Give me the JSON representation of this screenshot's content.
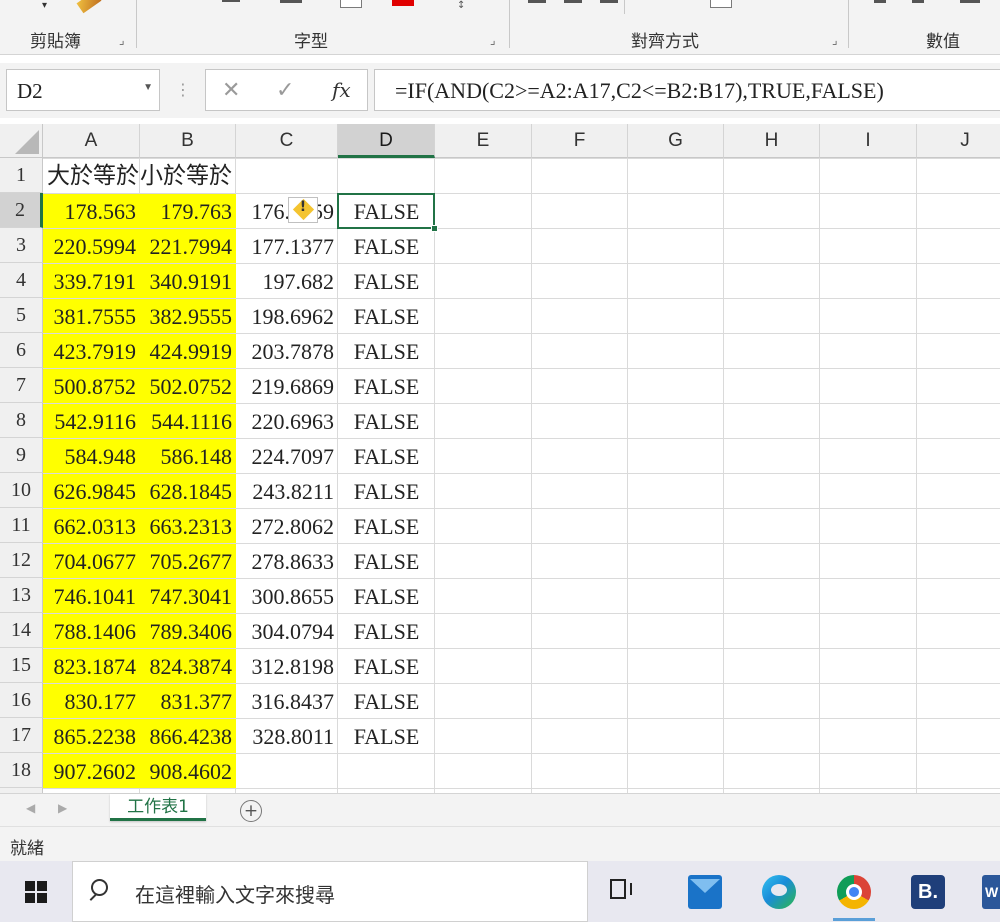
{
  "ribbon": {
    "groups": [
      {
        "label": "剪貼簿"
      },
      {
        "label": "字型"
      },
      {
        "label": "對齊方式"
      },
      {
        "label": "數值"
      }
    ]
  },
  "formula_bar": {
    "name_box": "D2",
    "formula": "=IF(AND(C2>=A2:A17,C2<=B2:B17),TRUE,FALSE)",
    "cancel_glyph": "✕",
    "enter_glyph": "✓",
    "fx_glyph": "fx"
  },
  "sheet": {
    "columns": [
      "A",
      "B",
      "C",
      "D",
      "E",
      "F",
      "G",
      "H",
      "I",
      "J"
    ],
    "active_column": "D",
    "active_row": 2,
    "header_row": {
      "a": "大於等於",
      "b": "小於等於"
    },
    "rows": [
      {
        "num": "2",
        "a": "178.563",
        "b": "179.763",
        "c": "176.1759",
        "d": "FALSE"
      },
      {
        "num": "3",
        "a": "220.5994",
        "b": "221.7994",
        "c": "177.1377",
        "d": "FALSE"
      },
      {
        "num": "4",
        "a": "339.7191",
        "b": "340.9191",
        "c": "197.682",
        "d": "FALSE"
      },
      {
        "num": "5",
        "a": "381.7555",
        "b": "382.9555",
        "c": "198.6962",
        "d": "FALSE"
      },
      {
        "num": "6",
        "a": "423.7919",
        "b": "424.9919",
        "c": "203.7878",
        "d": "FALSE"
      },
      {
        "num": "7",
        "a": "500.8752",
        "b": "502.0752",
        "c": "219.6869",
        "d": "FALSE"
      },
      {
        "num": "8",
        "a": "542.9116",
        "b": "544.1116",
        "c": "220.6963",
        "d": "FALSE"
      },
      {
        "num": "9",
        "a": "584.948",
        "b": "586.148",
        "c": "224.7097",
        "d": "FALSE"
      },
      {
        "num": "10",
        "a": "626.9845",
        "b": "628.1845",
        "c": "243.8211",
        "d": "FALSE"
      },
      {
        "num": "11",
        "a": "662.0313",
        "b": "663.2313",
        "c": "272.8062",
        "d": "FALSE"
      },
      {
        "num": "12",
        "a": "704.0677",
        "b": "705.2677",
        "c": "278.8633",
        "d": "FALSE"
      },
      {
        "num": "13",
        "a": "746.1041",
        "b": "747.3041",
        "c": "300.8655",
        "d": "FALSE"
      },
      {
        "num": "14",
        "a": "788.1406",
        "b": "789.3406",
        "c": "304.0794",
        "d": "FALSE"
      },
      {
        "num": "15",
        "a": "823.1874",
        "b": "824.3874",
        "c": "312.8198",
        "d": "FALSE"
      },
      {
        "num": "16",
        "a": "830.177",
        "b": "831.377",
        "c": "316.8437",
        "d": "FALSE"
      },
      {
        "num": "17",
        "a": "865.2238",
        "b": "866.4238",
        "c": "328.8011",
        "d": "FALSE"
      },
      {
        "num": "18",
        "a": "907.2602",
        "b": "908.4602",
        "c": "",
        "d": ""
      }
    ],
    "highlight_color": "#ffff00",
    "accent_color": "#217346"
  },
  "tabs": {
    "sheet_name": "工作表1",
    "add_glyph": "+"
  },
  "status": {
    "text": "就緒"
  },
  "taskbar": {
    "search_placeholder": "在這裡輸入文字來搜尋",
    "b_app_letter": "B.",
    "word_letter": "W"
  }
}
